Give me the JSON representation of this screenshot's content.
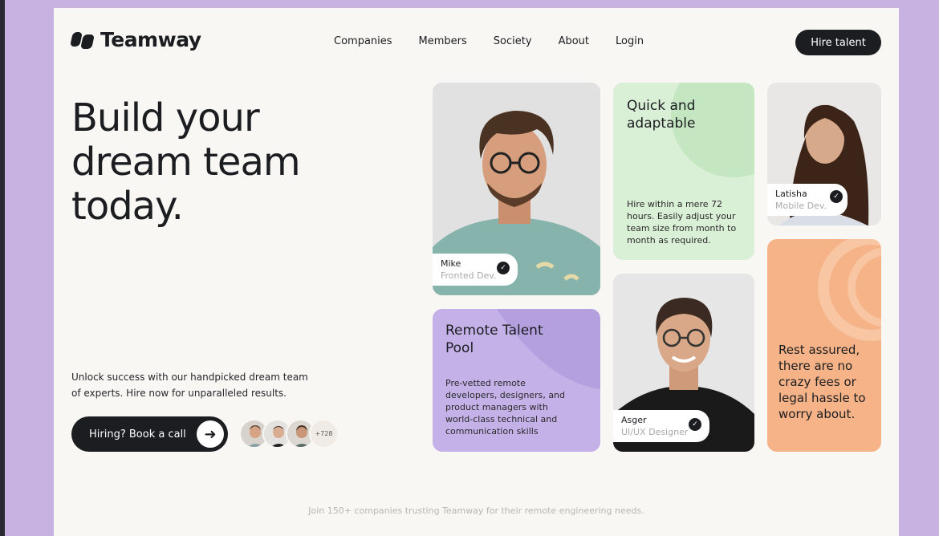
{
  "brand": {
    "name": "Teamway"
  },
  "nav": {
    "items": [
      "Companies",
      "Members",
      "Society",
      "About",
      "Login"
    ],
    "cta": "Hire talent"
  },
  "hero": {
    "headline": [
      "Build your",
      "dream team",
      "today."
    ],
    "description": "Unlock success with our handpicked dream team of experts. Hire now for unparalleled results.",
    "cta_label": "Hiring? Book a call",
    "avatar_count": "+728"
  },
  "cards": {
    "mike": {
      "name": "Mike",
      "role": "Fronted Dev."
    },
    "quick": {
      "title": "Quick and adaptable",
      "body": "Hire within a mere 72 hours. Easily adjust your team size from month to month as required."
    },
    "latisha": {
      "name": "Latisha",
      "role": "Mobile Dev."
    },
    "remote": {
      "title": "Remote Talent Pool",
      "body": "Pre-vetted remote developers, designers, and product managers with world-class technical and communication skills"
    },
    "asger": {
      "name": "Asger",
      "role": "UI/UX Designer"
    },
    "rest": {
      "title": "Rest assured, there are no crazy fees or legal hassle to worry about."
    }
  },
  "footer": {
    "text": "Join 150+ companies trusting Teamway for their remote engineering needs."
  },
  "colors": {
    "dark": "#1c1d21",
    "green": "#d9efd6",
    "purple": "#c3b1e8",
    "orange": "#f5b387",
    "frame": "#c7b2e2"
  },
  "icons": {
    "arrow": "arrow-right-icon",
    "check": "verified-check-icon"
  }
}
